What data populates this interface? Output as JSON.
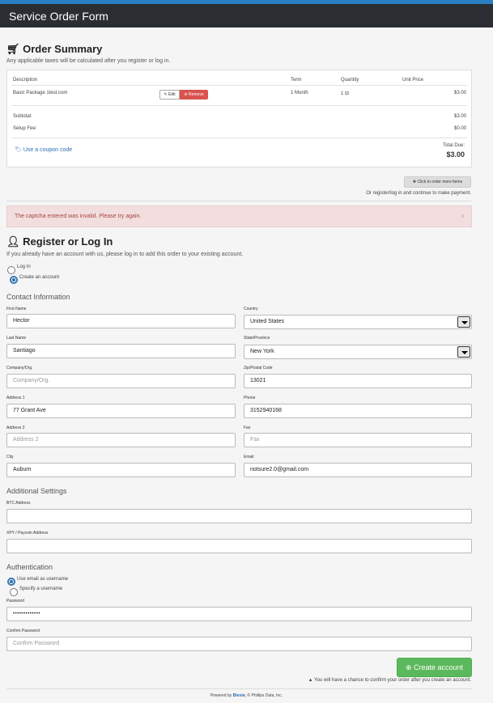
{
  "header": {
    "title": "Service Order Form"
  },
  "order_summary": {
    "title": "Order Summary",
    "note": "Any applicable taxes will be calculated after you register or log in.",
    "columns": [
      "Description",
      "Term",
      "Quantity",
      "Unit Price"
    ],
    "item": {
      "description": "Basic Package 1test.com",
      "edit_label": "Edit",
      "remove_label": "Remove",
      "term": "1 Month",
      "quantity": "1",
      "unit_price": "$3.00"
    },
    "subtotal_label": "Subtotal:",
    "subtotal_value": "$3.00",
    "setup_label": "Setup Fee:",
    "setup_value": "$0.00",
    "coupon_label": "Use a coupon code",
    "total_label": "Total Due:",
    "total_value": "$3.00",
    "more_items_label": "Click to order more items",
    "register_hint": "Or register/log in and continue to make payment."
  },
  "alert": {
    "message": "The captcha entered was invalid. Please try again.",
    "close": "×"
  },
  "register": {
    "title": "Register or Log In",
    "intro": "If you already have an account with us, please log in to add this order to your existing account.",
    "option_login": "Log In",
    "option_create": "Create an account"
  },
  "contact": {
    "title": "Contact Information",
    "first_name_label": "First Name",
    "first_name": "Hector",
    "country_label": "Country",
    "country": "United States",
    "last_name_label": "Last Name",
    "last_name": "Santiago",
    "state_label": "State/Province",
    "state": "New York",
    "company_label": "Company/Org.",
    "company_placeholder": "Company/Org.",
    "zip_label": "Zip/Postal Code",
    "zip": "13021",
    "address1_label": "Address 1",
    "address1": "77 Grant Ave",
    "phone_label": "Phone",
    "phone": "3152940168",
    "address2_label": "Address 2",
    "address2_placeholder": "Address 2",
    "fax_label": "Fax",
    "fax_placeholder": "Fax",
    "city_label": "City",
    "city": "Auburn",
    "email_label": "Email",
    "email": "notsure2.0@gmail.com"
  },
  "additional": {
    "title": "Additional Settings",
    "btc_label": "BTC Address",
    "xpy_label": "XPY / Paycoin Address"
  },
  "auth": {
    "title": "Authentication",
    "opt_email": "Use email as username",
    "opt_specify": "Specify a username",
    "password_label": "Password",
    "password_value": "•••••••••••••",
    "confirm_label": "Confirm Password",
    "confirm_placeholder": "Confirm Password",
    "create_label": "Create account",
    "confirm_note": "You will have a chance to confirm your order after you create an account."
  },
  "footer": {
    "prefix": "Powered by ",
    "brand": "Blesta",
    "suffix": ", © Phillips Data, Inc."
  }
}
